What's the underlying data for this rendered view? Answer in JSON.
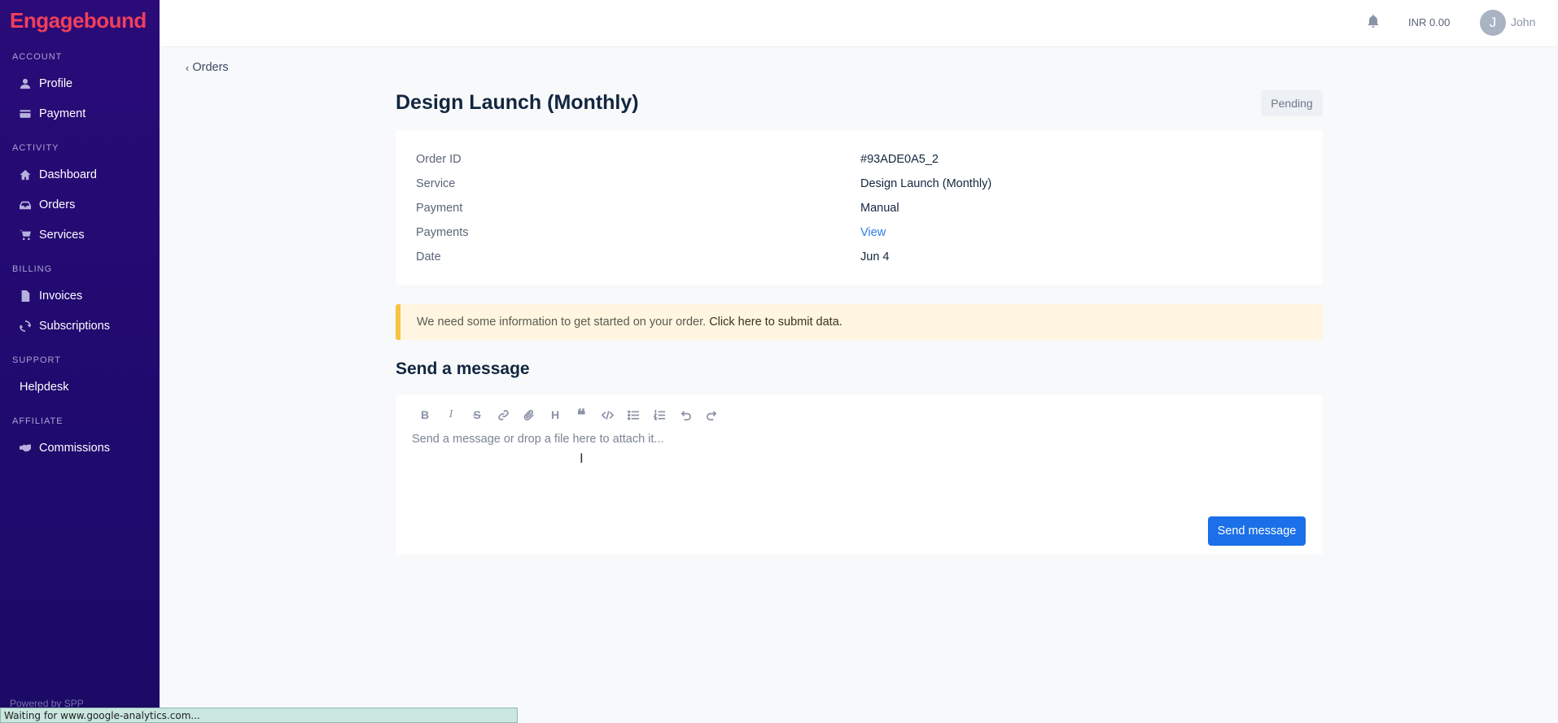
{
  "brand": "Engagebound",
  "sidebar": {
    "sections": [
      {
        "title": "ACCOUNT",
        "items": [
          {
            "label": "Profile",
            "icon": "user-icon"
          },
          {
            "label": "Payment",
            "icon": "credit-card-icon"
          }
        ]
      },
      {
        "title": "ACTIVITY",
        "items": [
          {
            "label": "Dashboard",
            "icon": "home-icon"
          },
          {
            "label": "Orders",
            "icon": "inbox-icon"
          },
          {
            "label": "Services",
            "icon": "cart-icon"
          }
        ]
      },
      {
        "title": "BILLING",
        "items": [
          {
            "label": "Invoices",
            "icon": "file-icon"
          },
          {
            "label": "Subscriptions",
            "icon": "refresh-icon"
          }
        ]
      },
      {
        "title": "SUPPORT",
        "items": [
          {
            "label": "Helpdesk",
            "icon": ""
          }
        ]
      },
      {
        "title": "AFFILIATE",
        "items": [
          {
            "label": "Commissions",
            "icon": "handshake-icon"
          }
        ]
      }
    ],
    "powered_by": "Powered by SPP"
  },
  "header": {
    "balance": "INR 0.00",
    "avatar_initial": "J",
    "username": "John"
  },
  "breadcrumb": {
    "back_label": "Orders"
  },
  "order": {
    "title": "Design Launch (Monthly)",
    "status": "Pending",
    "details": [
      {
        "label": "Order ID",
        "value": "#93ADE0A5_2"
      },
      {
        "label": "Service",
        "value": "Design Launch (Monthly)"
      },
      {
        "label": "Payment",
        "value": "Manual"
      },
      {
        "label": "Payments",
        "value": "View"
      },
      {
        "label": "Date",
        "value": "Jun 4"
      }
    ]
  },
  "alert": {
    "text": "We need some information to get started on your order.",
    "link": "Click here to submit data."
  },
  "message": {
    "title": "Send a message",
    "placeholder": "Send a message or drop a file here to attach it...",
    "send_label": "Send message",
    "toolbar": [
      "bold-icon",
      "italic-icon",
      "strikethrough-icon",
      "link-icon",
      "attachment-icon",
      "heading-icon",
      "quote-icon",
      "code-icon",
      "bullet-list-icon",
      "numbered-list-icon",
      "undo-icon",
      "redo-icon"
    ]
  },
  "browser_status": "Waiting for www.google-analytics.com..."
}
